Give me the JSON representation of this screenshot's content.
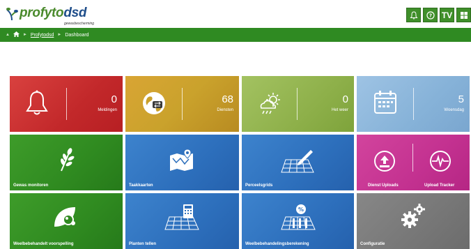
{
  "app": {
    "logo_part1": "profyto",
    "logo_part2": "dsd",
    "logo_sub": "gewasbescherming"
  },
  "top_buttons": [
    {
      "icon": "bell-outline-icon"
    },
    {
      "icon": "help-circle-icon"
    },
    {
      "label": "TV"
    },
    {
      "icon": "grid-icon"
    }
  ],
  "breadcrumb": {
    "items": [
      "Profytodsd",
      "Dashboard"
    ]
  },
  "tiles": [
    {
      "count": "0",
      "sublabel": "Meldingen",
      "icon": "bell-icon",
      "color": "#c8302f"
    },
    {
      "count": "68",
      "sublabel": "Diensten",
      "icon": "globe-exchange-icon",
      "color": "#caa02c"
    },
    {
      "count": "0",
      "sublabel": "Het weer",
      "icon": "weather-icon",
      "color": "#90b24c"
    },
    {
      "count": "5",
      "sublabel": "Woensdag",
      "icon": "calendar-icon",
      "color": "#86b2d8"
    },
    {
      "label": "Gewas monitoren",
      "icon": "wheat-icon",
      "color": "#2f8a20"
    },
    {
      "label": "Taakkaarten",
      "icon": "map-pin-icon",
      "color": "#2d6fbc"
    },
    {
      "label": "Perceelsgrids",
      "icon": "grid-pencil-icon",
      "color": "#2d6fbc"
    },
    {
      "label_left": "Dienst Uploads",
      "label_right": "Upload Tracker",
      "icon_left": "upload-icon",
      "icon_right": "heartbeat-icon",
      "color": "#c33190"
    },
    {
      "label": "Weelbebehandelt voorspelling",
      "icon": "leaf-drops-icon",
      "color": "#2f8a20"
    },
    {
      "label": "Planten tellen",
      "icon": "calculator-grid-icon",
      "color": "#2d6fbc"
    },
    {
      "label": "Weelbebehandelingsberekening",
      "icon": "percent-grid-icon",
      "color": "#2d6fbc"
    },
    {
      "label": "Configuratie",
      "icon": "gears-icon",
      "color": "#777777"
    }
  ]
}
